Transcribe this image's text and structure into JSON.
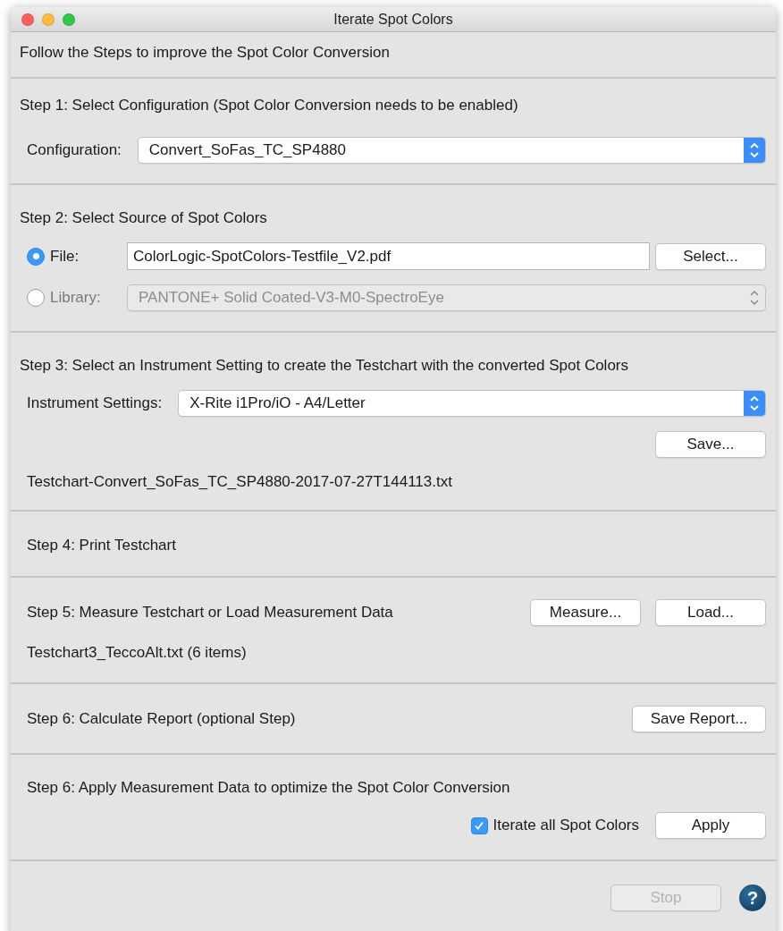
{
  "window": {
    "title": "Iterate Spot Colors"
  },
  "intro": "Follow the Steps to improve the Spot Color Conversion",
  "step1": {
    "heading": "Step 1: Select Configuration (Spot Color Conversion needs to be enabled)",
    "label": "Configuration:",
    "value": "Convert_SoFas_TC_SP4880"
  },
  "step2": {
    "heading": "Step 2: Select Source of Spot Colors",
    "sources": [
      {
        "kind": "field",
        "label": "File:",
        "selected": true,
        "disabled": false,
        "value": "ColorLogic-SpotColors-Testfile_V2.pdf",
        "button": "Select..."
      },
      {
        "kind": "select",
        "label": "Library:",
        "selected": false,
        "disabled": true,
        "value": "PANTONE+ Solid Coated-V3-M0-SpectroEye"
      }
    ]
  },
  "step3": {
    "heading": "Step 3: Select an Instrument Setting to create the Testchart with the converted Spot Colors",
    "label": "Instrument Settings:",
    "value": "X-Rite i1Pro/iO - A4/Letter",
    "button": "Save...",
    "file": "Testchart-Convert_SoFas_TC_SP4880-2017-07-27T144113.txt"
  },
  "step4": {
    "heading": "Step 4: Print Testchart"
  },
  "step5": {
    "heading": "Step 5: Measure Testchart or Load Measurement Data",
    "buttons": [
      "Measure...",
      "Load..."
    ],
    "file": "Testchart3_TeccoAlt.txt (6 items)"
  },
  "step6": {
    "heading": "Step 6: Calculate Report (optional Step)",
    "button": "Save Report..."
  },
  "step7": {
    "heading": "Step 6: Apply Measurement Data to optimize the Spot Color Conversion",
    "checkbox": {
      "label": "Iterate all Spot Colors",
      "checked": true
    },
    "button": "Apply"
  },
  "footer": {
    "stop": {
      "label": "Stop",
      "disabled": true
    },
    "help": "?"
  }
}
